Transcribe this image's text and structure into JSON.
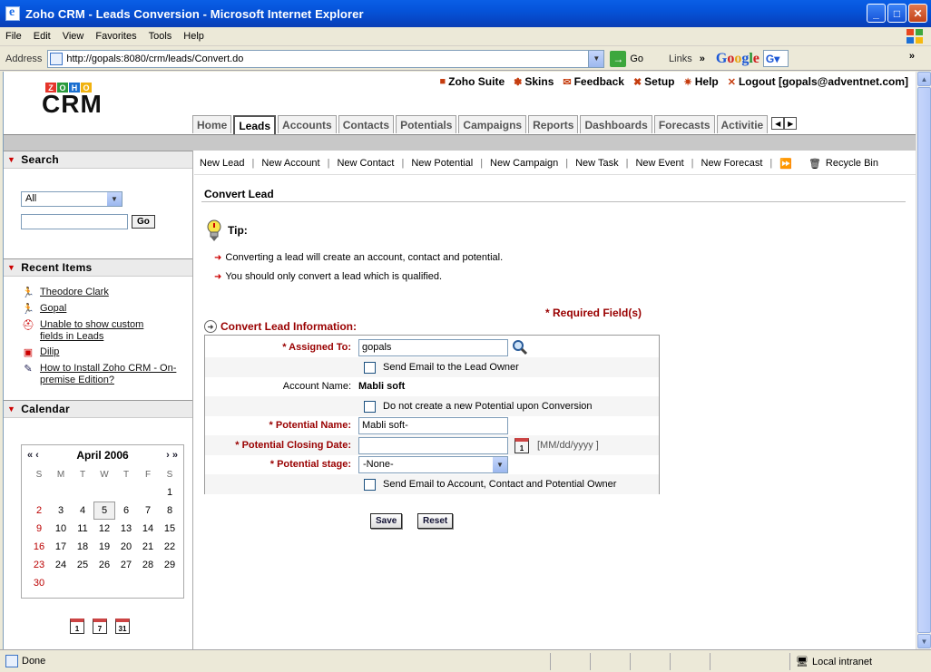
{
  "window": {
    "title": "Zoho CRM - Leads Conversion - Microsoft Internet Explorer"
  },
  "menu": [
    "File",
    "Edit",
    "View",
    "Favorites",
    "Tools",
    "Help"
  ],
  "address": {
    "label": "Address",
    "url": "http://gopals:8080/crm/leads/Convert.do",
    "go_label": "Go",
    "links_label": "Links"
  },
  "header": {
    "logo_top": "ZOHO",
    "logo_main": "CRM",
    "toplinks": [
      {
        "label": "Zoho Suite",
        "icon": "zoho-icon"
      },
      {
        "label": "Skins",
        "icon": "skins-icon"
      },
      {
        "label": "Feedback",
        "icon": "mail-icon"
      },
      {
        "label": "Setup",
        "icon": "tools-icon"
      },
      {
        "label": "Help",
        "icon": "help-icon"
      },
      {
        "label": "Logout [gopals@adventnet.com]",
        "icon": "close-icon"
      }
    ],
    "tabs": [
      "Home",
      "Leads",
      "Accounts",
      "Contacts",
      "Potentials",
      "Campaigns",
      "Reports",
      "Dashboards",
      "Forecasts",
      "Activitie"
    ],
    "active_tab": "Leads"
  },
  "actions": [
    "New Lead",
    "New Account",
    "New Contact",
    "New Potential",
    "New Campaign",
    "New Task",
    "New Event",
    "New Forecast"
  ],
  "recycle_label": "Recycle Bin",
  "sidebar": {
    "search": {
      "title": "Search",
      "select_value": "All",
      "go_label": "Go"
    },
    "recent": {
      "title": "Recent Items",
      "items": [
        {
          "label": "Theodore Clark",
          "icon": "lead-icon"
        },
        {
          "label": "Gopal",
          "icon": "lead-icon"
        },
        {
          "label": "Unable to show custom fields in Leads",
          "icon": "case-icon"
        },
        {
          "label": "Dilip",
          "icon": "contact-icon"
        },
        {
          "label": "How to Install Zoho CRM - On-premise Edition?",
          "icon": "solution-icon"
        }
      ]
    },
    "calendar": {
      "title": "Calendar",
      "month": "April 2006",
      "prev": "« ‹",
      "next": "› »",
      "dow": [
        "S",
        "M",
        "T",
        "W",
        "T",
        "F",
        "S"
      ],
      "weeks": [
        [
          "",
          "",
          "",
          "",
          "",
          "",
          "1"
        ],
        [
          "2",
          "3",
          "4",
          "5",
          "6",
          "7",
          "8"
        ],
        [
          "9",
          "10",
          "11",
          "12",
          "13",
          "14",
          "15"
        ],
        [
          "16",
          "17",
          "18",
          "19",
          "20",
          "21",
          "22"
        ],
        [
          "23",
          "24",
          "25",
          "26",
          "27",
          "28",
          "29"
        ],
        [
          "30",
          "",
          "",
          "",
          "",
          "",
          ""
        ]
      ],
      "today": "5",
      "view_icons": [
        "1",
        "7",
        "31"
      ]
    }
  },
  "main": {
    "title": "Convert Lead",
    "tip_title": "Tip:",
    "tips": [
      "Converting a lead will create an account, contact and potential.",
      "You should only convert a lead which is qualified."
    ],
    "required_note": "* Required Field(s)",
    "section_title": "Convert Lead Information:",
    "form": {
      "assigned_label": "* Assigned To:",
      "assigned_value": "gopals",
      "send_email_owner": "Send Email to the Lead Owner",
      "account_label": "Account Name:",
      "account_value": "Mabli soft",
      "no_potential": "Do not create a new Potential upon Conversion",
      "potential_name_label": "* Potential Name:",
      "potential_name_value": "Mabli soft-",
      "closing_date_label": "* Potential Closing Date:",
      "closing_date_value": "",
      "date_format": "[MM/dd/yyyy ]",
      "stage_label": "* Potential stage:",
      "stage_value": "-None-",
      "send_email_all": "Send Email to Account, Contact and Potential Owner"
    },
    "save_label": "Save",
    "reset_label": "Reset"
  },
  "status": {
    "text": "Done",
    "zone": "Local intranet"
  }
}
